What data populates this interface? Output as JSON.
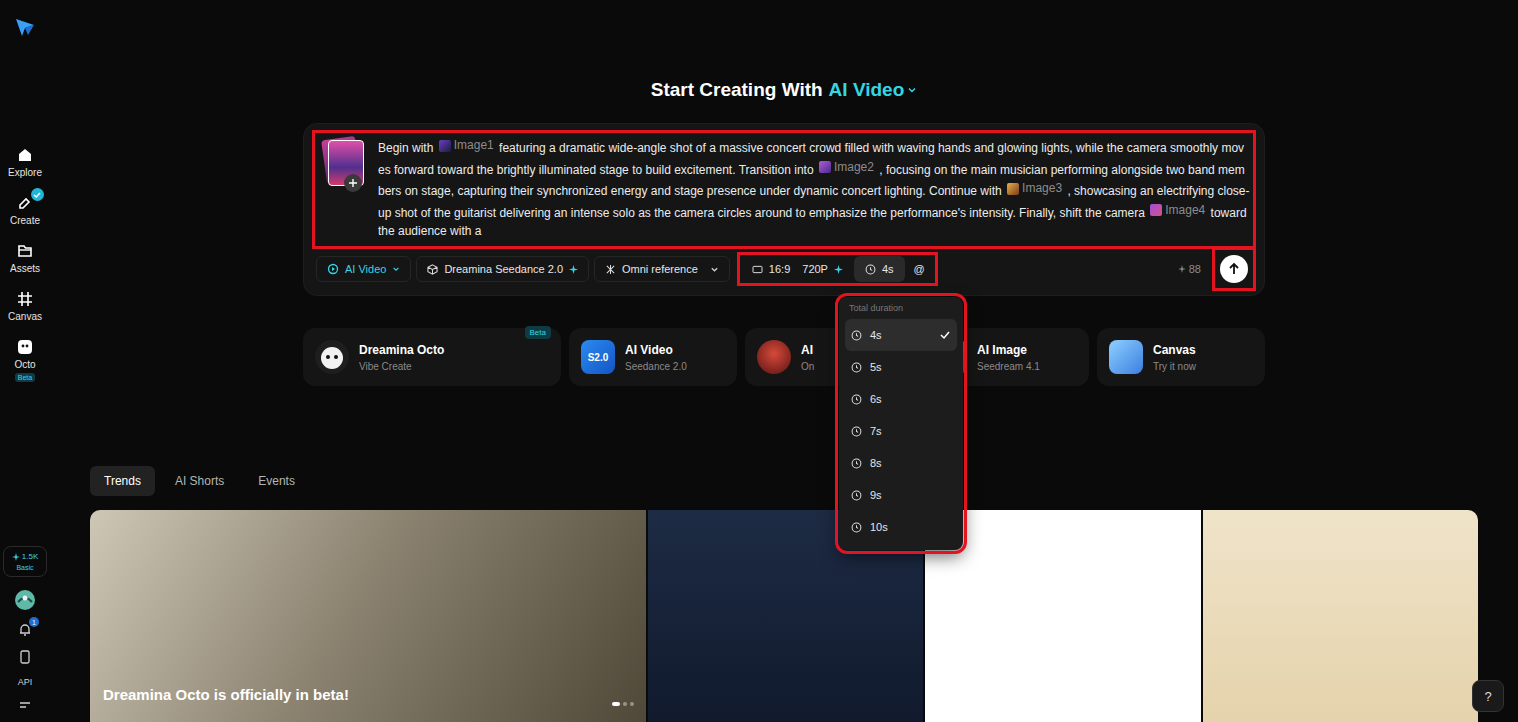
{
  "sidebar": {
    "items": [
      {
        "label": "Explore",
        "selected": false,
        "badge": false,
        "tag": ""
      },
      {
        "label": "Create",
        "selected": false,
        "badge": true,
        "tag": ""
      },
      {
        "label": "Assets",
        "selected": false,
        "badge": false,
        "tag": ""
      },
      {
        "label": "Canvas",
        "selected": false,
        "badge": false,
        "tag": ""
      },
      {
        "label": "Octo",
        "selected": false,
        "badge": false,
        "tag": "Beta"
      }
    ],
    "credits": {
      "amount": "1.5K",
      "plan": "Basic"
    },
    "notifications": "1",
    "api": "API"
  },
  "title": {
    "prefix": "Start Creating With",
    "mode": "AI Video"
  },
  "prompt": {
    "segments": [
      {
        "kind": "text",
        "text": "Begin with "
      },
      {
        "kind": "ref",
        "text": "Image1"
      },
      {
        "kind": "text",
        "text": " featuring a dramatic wide-angle shot of a massive concert crowd filled with waving hands and glowing lights, while the camera smoothly moves forward toward the brightly illuminated stage to build excitement. Transition into "
      },
      {
        "kind": "ref",
        "text": "Image2"
      },
      {
        "kind": "text",
        "text": " , focusing on the main musician performing alongside two band members on stage, capturing their synchronized energy and stage presence under dynamic concert lighting. Continue with "
      },
      {
        "kind": "ref",
        "text": "Image3"
      },
      {
        "kind": "text",
        "text": " , showcasing an electrifying close-up shot of the guitarist delivering an intense solo as the camera circles around to emphasize the performance's intensity. Finally, shift the camera "
      },
      {
        "kind": "ref",
        "text": "Image4"
      },
      {
        "kind": "text",
        "text": " toward the audience with a"
      }
    ]
  },
  "toolbar": {
    "mode": "AI Video",
    "model": "Dreamina Seedance 2.0",
    "reference": "Omni reference",
    "ratio": "16:9",
    "resolution": "720P",
    "duration": "4s",
    "duration_open": true,
    "mention": "@",
    "cost": "88"
  },
  "duration_menu": {
    "title": "Total duration",
    "options": [
      {
        "label": "4s",
        "selected": true
      },
      {
        "label": "5s",
        "selected": false
      },
      {
        "label": "6s",
        "selected": false
      },
      {
        "label": "7s",
        "selected": false
      },
      {
        "label": "8s",
        "selected": false
      },
      {
        "label": "9s",
        "selected": false
      },
      {
        "label": "10s",
        "selected": false
      }
    ]
  },
  "cards": [
    {
      "kind": "octo",
      "title": "Dreamina Octo",
      "subtitle": "Vibe Create",
      "badge": "Beta",
      "icon_text": ""
    },
    {
      "kind": "video",
      "title": "AI Video",
      "subtitle": "Seedance 2.0",
      "badge": "",
      "icon_text": "S2.0"
    },
    {
      "kind": "avatar",
      "title": "AI",
      "subtitle": "On",
      "badge": "",
      "icon_text": ""
    },
    {
      "kind": "image",
      "title": "AI Image",
      "subtitle": "Seedream 4.1",
      "badge": "",
      "icon_text": ""
    },
    {
      "kind": "canvas",
      "title": "Canvas",
      "subtitle": "Try it now",
      "badge": "",
      "icon_text": ""
    }
  ],
  "tabs": [
    {
      "label": "Trends",
      "selected": true
    },
    {
      "label": "AI Shorts",
      "selected": false
    },
    {
      "label": "Events",
      "selected": false
    }
  ],
  "gallery": [
    {
      "kind": "banner",
      "caption": "Dreamina Octo is officially in beta!",
      "slides": [
        {
          "selected": true
        },
        {
          "selected": false
        },
        {
          "selected": false
        }
      ]
    },
    {
      "kind": "image",
      "caption": "",
      "slides": []
    },
    {
      "kind": "image",
      "caption": "",
      "slides": []
    },
    {
      "kind": "image",
      "caption": "",
      "slides": []
    }
  ],
  "help": "?"
}
